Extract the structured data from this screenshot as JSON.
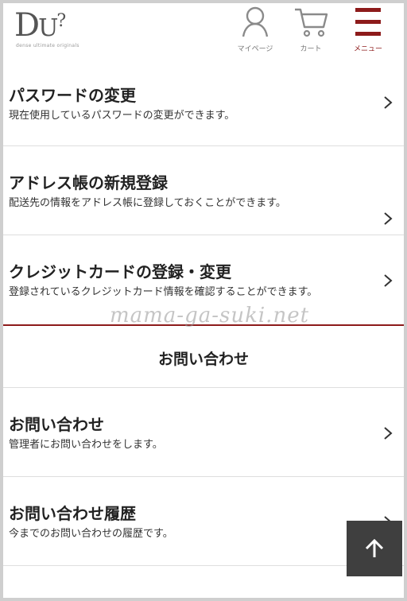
{
  "header": {
    "logo_text": "DUO",
    "logo_sub": "dense ultimate originals",
    "mypage_label": "マイページ",
    "cart_label": "カート",
    "menu_label": "メニュー",
    "accent_color": "#8d1b1b"
  },
  "account_items": [
    {
      "title": "パスワードの変更",
      "desc": "現在使用しているパスワードの変更ができます。"
    },
    {
      "title": "アドレス帳の新規登録",
      "desc": "配送先の情報をアドレス帳に登録しておくことができます。"
    },
    {
      "title": "クレジットカードの登録・変更",
      "desc": "登録されているクレジットカード情報を確認することができます。"
    }
  ],
  "watermark": "mama-ga-suki.net",
  "contact_section": {
    "heading": "お問い合わせ",
    "items": [
      {
        "title": "お問い合わせ",
        "desc": "管理者にお問い合わせをします。"
      },
      {
        "title": "お問い合わせ履歴",
        "desc": "今までのお問い合わせの履歴です。"
      }
    ]
  },
  "icons": {
    "mypage": "user-icon",
    "cart": "cart-icon",
    "menu": "hamburger-icon",
    "chevron": "chevron-right-icon",
    "back_to_top": "arrow-up-icon"
  }
}
